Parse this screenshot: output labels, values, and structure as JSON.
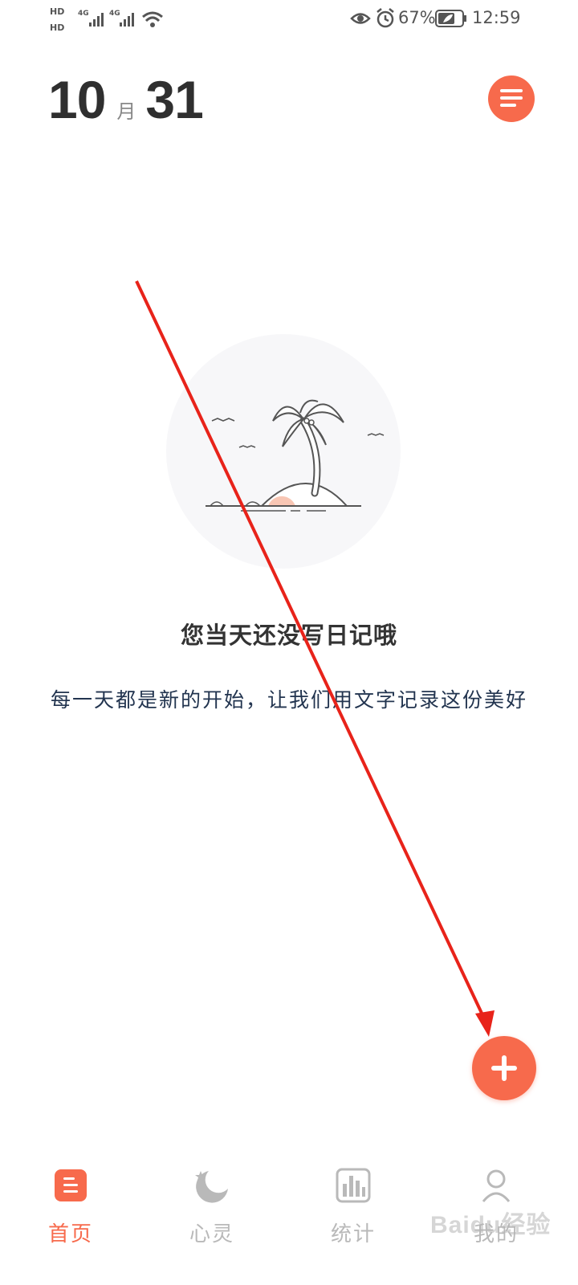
{
  "status_bar": {
    "hd1": "HD",
    "hd2": "HD",
    "net1": "4G",
    "net2": "4G",
    "battery": "67%",
    "time": "12:59",
    "icons": [
      "signal-icon",
      "wifi-icon",
      "eye-icon",
      "alarm-icon",
      "battery-icon"
    ]
  },
  "header": {
    "month": "10",
    "month_unit": "月",
    "day": "31",
    "menu_icon": "menu-lines-icon"
  },
  "empty_state": {
    "illustration": "island-palm-tree-illustration",
    "title": "您当天还没写日记哦",
    "subtitle": "每一天都是新的开始，让我们用文字记录这份美好"
  },
  "fab": {
    "icon": "plus-icon"
  },
  "tabs": [
    {
      "label": "首页",
      "icon": "home-doc-icon",
      "active": true
    },
    {
      "label": "心灵",
      "icon": "moon-star-icon",
      "active": false
    },
    {
      "label": "统计",
      "icon": "bar-chart-icon",
      "active": false
    },
    {
      "label": "我的",
      "icon": "user-icon",
      "active": false
    }
  ],
  "watermark": "Baidu经验",
  "colors": {
    "accent": "#F76A4C",
    "text_dark": "#2f2f2f",
    "text_muted": "#b9b9b9",
    "subtitle": "#22344f",
    "illus_bg": "#f7f7f9",
    "annotation_arrow": "#e8231a"
  }
}
